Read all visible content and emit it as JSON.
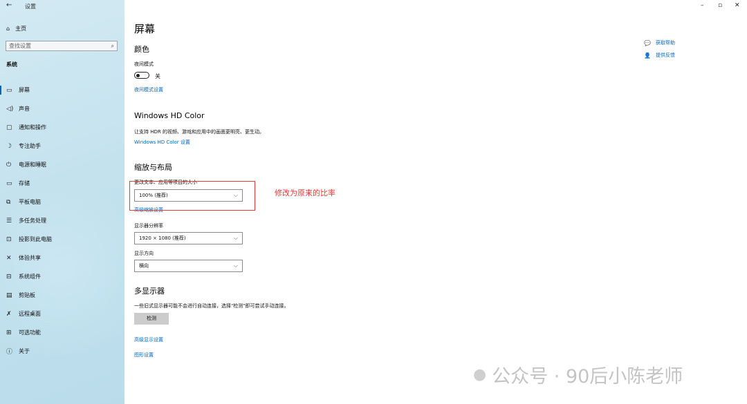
{
  "window": {
    "back_icon": "←",
    "title": "设置",
    "minimize": "–",
    "restore": "▫",
    "close": "✕"
  },
  "sidebar": {
    "home": {
      "icon": "⌂",
      "label": "主页"
    },
    "search_placeholder": "查找设置",
    "search_icon": "⌕",
    "section": "系统",
    "items": [
      {
        "icon": "▭",
        "label": "屏幕",
        "active": true
      },
      {
        "icon": "◁)",
        "label": "声音"
      },
      {
        "icon": "▢",
        "label": "通知和操作"
      },
      {
        "icon": "☽",
        "label": "专注助手"
      },
      {
        "icon": "⏻",
        "label": "电源和睡眠"
      },
      {
        "icon": "▭",
        "label": "存储"
      },
      {
        "icon": "⧉",
        "label": "平板电脑"
      },
      {
        "icon": "☰",
        "label": "多任务处理"
      },
      {
        "icon": "⊡",
        "label": "投影到此电脑"
      },
      {
        "icon": "✕",
        "label": "体验共享"
      },
      {
        "icon": "⊟",
        "label": "系统组件"
      },
      {
        "icon": "▤",
        "label": "剪贴板"
      },
      {
        "icon": "✗",
        "label": "远程桌面"
      },
      {
        "icon": "⊞",
        "label": "可选功能"
      },
      {
        "icon": "ⓘ",
        "label": "关于"
      }
    ]
  },
  "main": {
    "page_title": "屏幕",
    "color": {
      "heading": "颜色",
      "night_mode_label": "夜间模式",
      "toggle_state": "关",
      "night_mode_link": "夜间模式设置"
    },
    "hdr": {
      "heading": "Windows HD Color",
      "description": "让支持 HDR 的视频、游戏和应用中的画面更明亮、更生动。",
      "link": "Windows HD Color 设置"
    },
    "scale": {
      "heading": "缩放与布局",
      "text_size_label": "更改文本、应用等项目的大小",
      "text_size_value": "100% (推荐)",
      "advanced_link": "高级缩放设置",
      "resolution_label": "显示器分辨率",
      "resolution_value": "1920 × 1080 (推荐)",
      "orientation_label": "显示方向",
      "orientation_value": "横向"
    },
    "multi": {
      "heading": "多显示器",
      "description": "一些旧式显示器可能不会进行自动连接，选择\"检测\"即可尝试手动连接。",
      "detect_button": "检测",
      "advanced_display_link": "高级显示设置",
      "graphics_link": "图形设置"
    }
  },
  "help": {
    "get_help": "获取帮助",
    "feedback": "提供反馈"
  },
  "annotation": {
    "text": "修改为原来的比率",
    "color": "#e53935"
  },
  "watermark": {
    "text": "公众号 · 90后小陈老师"
  }
}
